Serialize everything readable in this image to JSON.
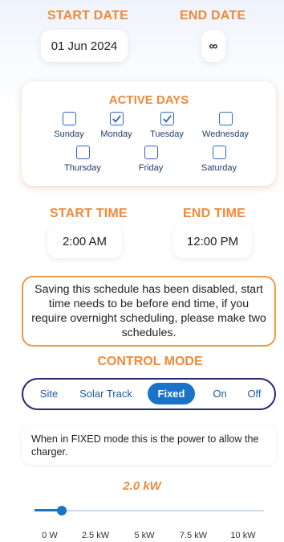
{
  "schedule": {
    "start_date_label": "START DATE",
    "end_date_label": "END DATE",
    "start_date_value": "01 Jun 2024",
    "end_date_value": "∞",
    "start_time_label": "START TIME",
    "end_time_label": "END TIME",
    "start_time_value": "2:00 AM",
    "end_time_value": "12:00 PM"
  },
  "active_days": {
    "title": "ACTIVE DAYS",
    "days": [
      {
        "label": "Sunday",
        "checked": false
      },
      {
        "label": "Monday",
        "checked": true
      },
      {
        "label": "Tuesday",
        "checked": true
      },
      {
        "label": "Wednesday",
        "checked": false
      },
      {
        "label": "Thursday",
        "checked": false
      },
      {
        "label": "Friday",
        "checked": false
      },
      {
        "label": "Saturday",
        "checked": false
      }
    ]
  },
  "warning": {
    "text": "Saving this schedule has been disabled, start time needs to be before end time, if you require overnight scheduling, please make two schedules."
  },
  "control_mode": {
    "title": "CONTROL MODE",
    "options": [
      "Site",
      "Solar Track",
      "Fixed",
      "On",
      "Off"
    ],
    "selected": "Fixed",
    "description": "When in FIXED mode this is the power to allow the charger."
  },
  "power_slider": {
    "value_label": "2.0 kW",
    "value_kw": 2.0,
    "min_kw": 0,
    "max_kw": 10,
    "ticks": [
      "0 W",
      "2.5 kW",
      "5 kW",
      "7.5 kW",
      "10 kW"
    ]
  },
  "colors": {
    "accent_orange": "#ef8a3a",
    "accent_blue": "#1a73c6",
    "mode_border": "#262673"
  }
}
